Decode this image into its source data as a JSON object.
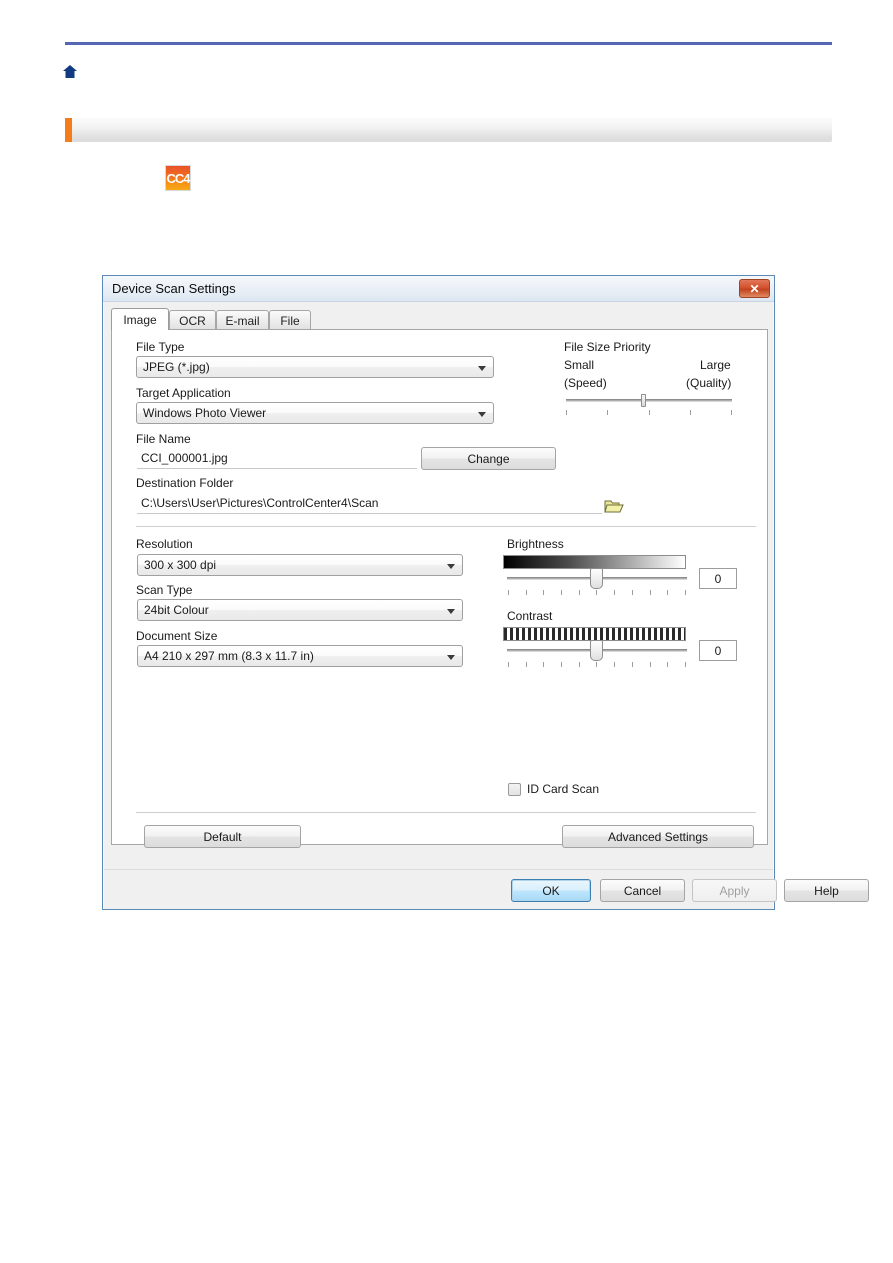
{
  "page": {
    "home_icon": "home-icon",
    "section_title": "",
    "app_icon_label": "CC4",
    "accent_color": "#f57c1b",
    "rule_color": "#5566b5"
  },
  "dialog": {
    "title": "Device Scan Settings",
    "close_label": "✕",
    "tabs": [
      {
        "label": "Image",
        "active": true
      },
      {
        "label": "OCR",
        "active": false
      },
      {
        "label": "E-mail",
        "active": false
      },
      {
        "label": "File",
        "active": false
      }
    ],
    "fields": {
      "file_type": {
        "label": "File Type",
        "value": "JPEG (*.jpg)"
      },
      "target_application": {
        "label": "Target Application",
        "value": "Windows Photo Viewer"
      },
      "file_name": {
        "label": "File Name",
        "value": "CCI_000001.jpg"
      },
      "change_button": "Change",
      "destination_folder": {
        "label": "Destination Folder",
        "value": "C:\\Users\\User\\Pictures\\ControlCenter4\\Scan"
      },
      "browse_icon": "folder-icon",
      "resolution": {
        "label": "Resolution",
        "value": "300 x 300 dpi"
      },
      "scan_type": {
        "label": "Scan Type",
        "value": "24bit Colour"
      },
      "document_size": {
        "label": "Document Size",
        "value": "A4 210 x 297 mm (8.3 x 11.7 in)"
      }
    },
    "file_size_priority": {
      "label": "File Size Priority",
      "small_label": "Small",
      "speed_label": "(Speed)",
      "large_label": "Large",
      "quality_label": "(Quality)",
      "tick_count": 5,
      "position_percent": 47
    },
    "brightness": {
      "label": "Brightness",
      "value": "0",
      "tick_count": 11,
      "position_percent": 50
    },
    "contrast": {
      "label": "Contrast",
      "value": "0",
      "tick_count": 11,
      "position_percent": 50
    },
    "id_card_scan": {
      "label": "ID Card Scan",
      "checked": false
    },
    "buttons": {
      "default": "Default",
      "advanced_settings": "Advanced Settings",
      "ok": "OK",
      "cancel": "Cancel",
      "apply": "Apply",
      "help": "Help"
    }
  }
}
